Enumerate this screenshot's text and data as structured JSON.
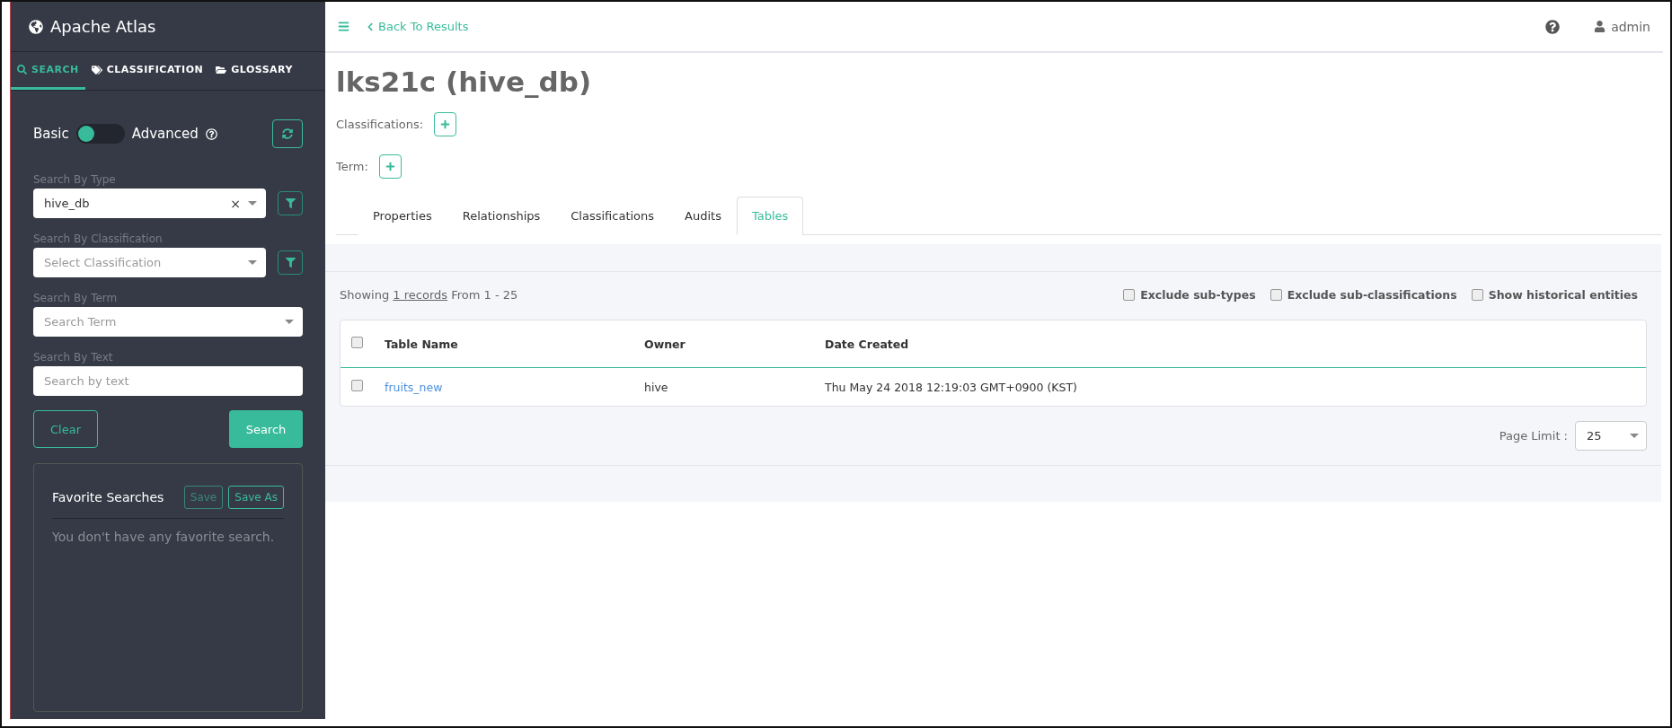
{
  "brand": "Apache Atlas",
  "side_tabs": [
    {
      "label": "SEARCH",
      "selected": true
    },
    {
      "label": "CLASSIFICATION",
      "selected": false
    },
    {
      "label": "GLOSSARY",
      "selected": false
    }
  ],
  "mode_toggle": {
    "left": "Basic",
    "right": "Advanced",
    "on": false
  },
  "filters": [
    {
      "label": "Search By Type",
      "value": "hive_db",
      "clearable": true,
      "clear_glyph": "×",
      "filter_button": true,
      "kind": "select"
    },
    {
      "label": "Search By Classification",
      "placeholder": "Select Classification",
      "filter_button": true,
      "kind": "select"
    },
    {
      "label": "Search By Term",
      "placeholder": "Search Term",
      "filter_button": false,
      "kind": "select"
    },
    {
      "label": "Search By Text",
      "placeholder": "Search by text",
      "filter_button": false,
      "kind": "text"
    }
  ],
  "buttons": {
    "clear": "Clear",
    "search": "Search"
  },
  "favorites": {
    "title": "Favorite Searches",
    "save": "Save",
    "save_disabled": true,
    "save_as": "Save As",
    "empty": "You don't have any favorite search."
  },
  "topbar": {
    "back": "Back To Results",
    "user": "admin"
  },
  "entity": {
    "title": "lks21c (hive_db)",
    "classifications_label": "Classifications:",
    "term_label": "Term:"
  },
  "tabs": [
    {
      "label": "Properties",
      "selected": false
    },
    {
      "label": "Relationships",
      "selected": false
    },
    {
      "label": "Classifications",
      "selected": false
    },
    {
      "label": "Audits",
      "selected": false
    },
    {
      "label": "Tables",
      "selected": true
    }
  ],
  "results": {
    "showing": "Showing",
    "records": "1 records",
    "range": "From 1 - 25",
    "options": [
      {
        "label": "Exclude sub-types",
        "checked": false
      },
      {
        "label": "Exclude sub-classifications",
        "checked": false
      },
      {
        "label": "Show historical entities",
        "checked": false
      }
    ],
    "select_all_checked": false,
    "columns": [
      "Table Name",
      "Owner",
      "Date Created"
    ],
    "rows": [
      {
        "name": "fruits_new",
        "owner": "hive",
        "created": "Thu May 24 2018 12:19:03 GMT+0900 (KST)",
        "checked": false
      }
    ],
    "page_limit_label": "Page Limit :",
    "page_limit": "25"
  }
}
